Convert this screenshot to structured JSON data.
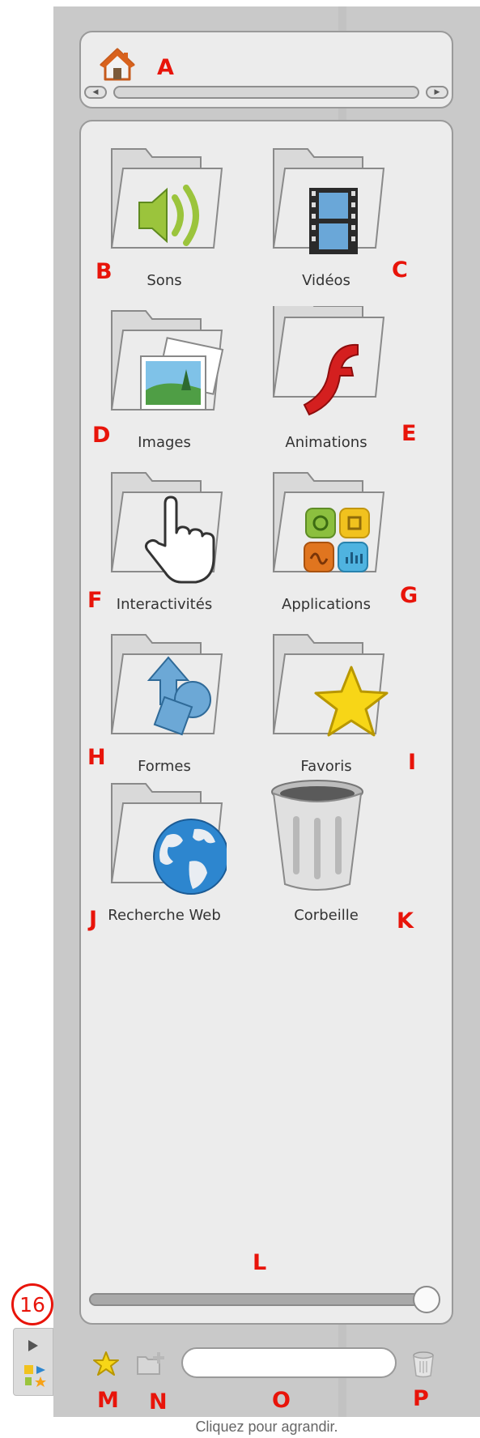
{
  "address": {
    "annotation": "A"
  },
  "items": [
    {
      "label": "Sons",
      "annotation": "B"
    },
    {
      "label": "Vidéos",
      "annotation": "C"
    },
    {
      "label": "Images",
      "annotation": "D"
    },
    {
      "label": "Animations",
      "annotation": "E"
    },
    {
      "label": "Interactivités",
      "annotation": "F"
    },
    {
      "label": "Applications",
      "annotation": "G"
    },
    {
      "label": "Formes",
      "annotation": "H"
    },
    {
      "label": "Favoris",
      "annotation": "I"
    },
    {
      "label": "Recherche Web",
      "annotation": "J"
    },
    {
      "label": "Corbeille",
      "annotation": "K"
    }
  ],
  "zoom_slider": {
    "annotation": "L",
    "level": 1.0
  },
  "toolbar": {
    "favorite_annotation": "M",
    "new_folder_annotation": "N",
    "search_annotation": "O",
    "trash_annotation": "P",
    "search_value": ""
  },
  "badge": {
    "number": "16"
  },
  "caption": "Cliquez pour agrandir.",
  "colors": {
    "annotation": "#e8140a",
    "panel": "#c9c9c9",
    "content": "#ececec"
  }
}
